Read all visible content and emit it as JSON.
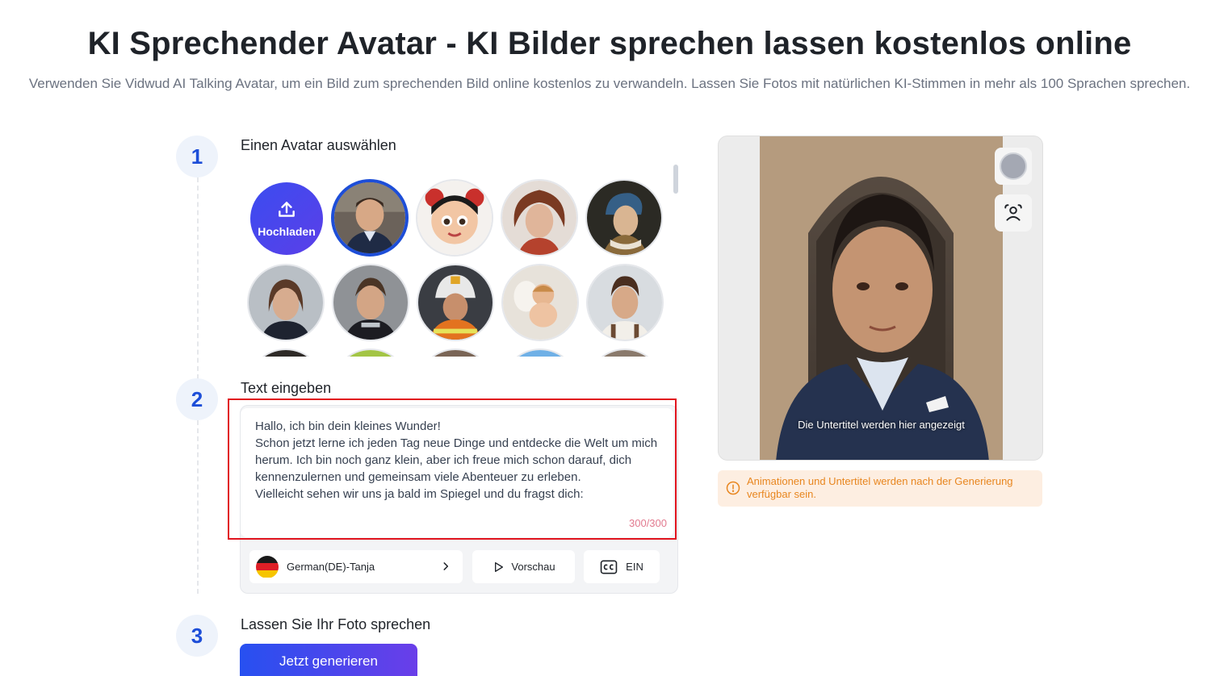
{
  "page": {
    "title": "KI Sprechender Avatar - KI Bilder sprechen lassen kostenlos online",
    "subtitle": "Verwenden Sie Vidwud AI Talking Avatar, um ein Bild zum sprechenden Bild online kostenlos zu verwandeln. Lassen Sie Fotos mit natürlichen KI-Stimmen in mehr als 100 Sprachen sprechen."
  },
  "steps": [
    {
      "number": "1",
      "label": "Einen Avatar auswählen"
    },
    {
      "number": "2",
      "label": "Text eingeben"
    },
    {
      "number": "3",
      "label": "Lassen Sie Ihr Foto sprechen"
    }
  ],
  "avatar_picker": {
    "upload_label": "Hochladen",
    "avatars": [
      {
        "name": "boy-in-suit",
        "selected": true
      },
      {
        "name": "cartoon-girl",
        "selected": false
      },
      {
        "name": "warrior-woman",
        "selected": false
      },
      {
        "name": "pearl-earring-girl",
        "selected": false
      },
      {
        "name": "female-racer",
        "selected": false
      },
      {
        "name": "male-racer",
        "selected": false
      },
      {
        "name": "firefighter",
        "selected": false
      },
      {
        "name": "cupid",
        "selected": false
      },
      {
        "name": "chef",
        "selected": false
      }
    ]
  },
  "text_input": {
    "value": "Hallo, ich bin dein kleines Wunder!\nSchon jetzt lerne ich jeden Tag neue Dinge und entdecke die Welt um mich herum. Ich bin noch ganz klein, aber ich freue mich schon darauf, dich kennenzulernen und gemeinsam viele Abenteuer zu erleben.\nVielleicht sehen wir uns ja bald im Spiegel und du fragst dich:",
    "counter": "300/300"
  },
  "controls": {
    "voice_label": "German(DE)-Tanja",
    "preview_label": "Vorschau",
    "captions_label": "EIN"
  },
  "generate_button": "Jetzt generieren",
  "preview": {
    "caption": "Die Untertitel werden hier angezeigt",
    "notice": "Animationen und Untertitel werden nach der Generierung verfügbar sein."
  },
  "colors": {
    "accent": "#1d4ed8",
    "highlight_border": "#e1141e",
    "notice_bg": "#fdeee1",
    "notice_text": "#e8861f"
  },
  "icons": [
    "upload-icon",
    "chevron-right-icon",
    "play-icon",
    "cc-icon",
    "info-icon",
    "record-icon",
    "face-scan-icon"
  ]
}
